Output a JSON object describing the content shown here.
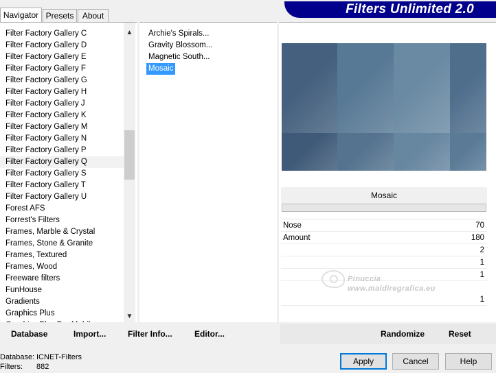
{
  "tabs": [
    {
      "label": "Navigator",
      "active": true
    },
    {
      "label": "Presets",
      "active": false
    },
    {
      "label": "About",
      "active": false
    }
  ],
  "title": "Filters Unlimited 2.0",
  "categories": [
    "Filter Factory Gallery C",
    "Filter Factory Gallery D",
    "Filter Factory Gallery E",
    "Filter Factory Gallery F",
    "Filter Factory Gallery G",
    "Filter Factory Gallery H",
    "Filter Factory Gallery J",
    "Filter Factory Gallery K",
    "Filter Factory Gallery M",
    "Filter Factory Gallery N",
    "Filter Factory Gallery P",
    "Filter Factory Gallery Q",
    "Filter Factory Gallery S",
    "Filter Factory Gallery T",
    "Filter Factory Gallery U",
    "Forest AFS",
    "Forrest's Filters",
    "Frames, Marble & Crystal",
    "Frames, Stone & Granite",
    "Frames, Textured",
    "Frames, Wood",
    "Freeware filters",
    "FunHouse",
    "Gradients",
    "Graphics Plus",
    "Graphics Plus Pro Mobile"
  ],
  "current_category_index": 11,
  "filters": [
    "Archie's Spirals...",
    "Gravity Blossom...",
    "Magnetic South...",
    "Mosaic"
  ],
  "selected_filter_index": 3,
  "filter_name": "Mosaic",
  "params": [
    {
      "label": "Nose",
      "value": "70"
    },
    {
      "label": "Amount",
      "value": "180"
    },
    {
      "label": "",
      "value": "2"
    },
    {
      "label": "",
      "value": "1"
    },
    {
      "label": "",
      "value": "1"
    },
    {
      "label": "",
      "value": "1"
    }
  ],
  "watermark": {
    "name": "Pinuccia",
    "site": "www.maidiregrafica.eu"
  },
  "left_buttons": [
    "Database",
    "Import...",
    "Filter Info...",
    "Editor..."
  ],
  "right_buttons": [
    "Randomize",
    "Reset"
  ],
  "footer": {
    "database_label": "Database:",
    "database_value": "ICNET-Filters",
    "filters_label": "Filters:",
    "filters_value": "882"
  },
  "dialog_buttons": {
    "apply": "Apply",
    "cancel": "Cancel",
    "help": "Help"
  },
  "colors": {
    "title_bar": "#00008c",
    "selection": "#3399ff",
    "preview_tiles": [
      "#44607e",
      "#587995",
      "#6a8aa3",
      "#4f6e8c",
      "#3f5a78",
      "#55738f",
      "#6786a0",
      "#5a7a96"
    ]
  }
}
